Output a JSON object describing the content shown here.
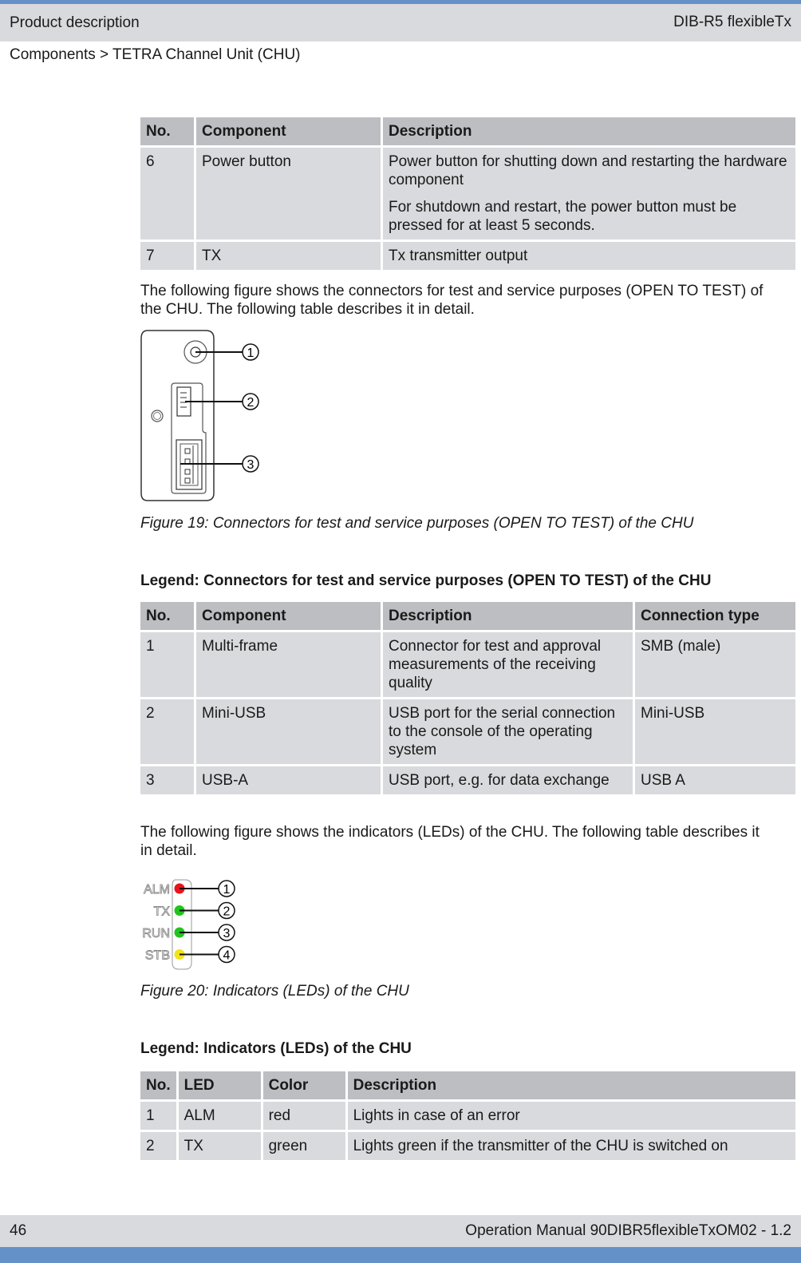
{
  "header": {
    "section": "Product description",
    "product": "DIB-R5 flexibleTx",
    "breadcrumb": "Components > TETRA Channel Unit (CHU)"
  },
  "table1": {
    "headers": [
      "No.",
      "Component",
      "Description"
    ],
    "rows": [
      {
        "no": "6",
        "component": "Power button",
        "description": [
          "Power button for shutting down and restarting the hardware component",
          "For shutdown and restart, the power button must be pressed for at least 5 seconds."
        ]
      },
      {
        "no": "7",
        "component": "TX",
        "description": [
          "Tx transmitter output"
        ]
      }
    ]
  },
  "para1": "The following figure shows the connectors for test and service purposes (OPEN TO TEST) of the CHU. The following table describes it in detail.",
  "figure19": {
    "callouts": [
      "1",
      "2",
      "3"
    ],
    "caption": "Figure 19: Connectors for test and service purposes (OPEN TO TEST) of the CHU"
  },
  "legend1": {
    "title": "Legend: Connectors for test and service purposes (OPEN TO TEST) of the CHU",
    "headers": [
      "No.",
      "Component",
      "Description",
      "Connection type"
    ],
    "rows": [
      {
        "no": "1",
        "component": "Multi-frame",
        "description": "Connector for test and approval measurements of the receiving quality",
        "type": "SMB (male)"
      },
      {
        "no": "2",
        "component": "Mini-USB",
        "description": "USB port for the serial connection to the console of the operating system",
        "type": "Mini-USB"
      },
      {
        "no": "3",
        "component": "USB-A",
        "description": "USB port, e.g. for data exchange",
        "type": "USB A"
      }
    ]
  },
  "para2": "The following figure shows the indicators (LEDs) of the CHU. The following table describes it in detail.",
  "figure20": {
    "leds": [
      {
        "label": "ALM",
        "callout": "1",
        "color": "#e8141a"
      },
      {
        "label": "TX",
        "callout": "2",
        "color": "#22c41e"
      },
      {
        "label": "RUN",
        "callout": "3",
        "color": "#22c41e"
      },
      {
        "label": "STB",
        "callout": "4",
        "color": "#f2e31a"
      }
    ],
    "caption": "Figure 20: Indicators (LEDs) of the CHU"
  },
  "legend2": {
    "title": "Legend: Indicators (LEDs) of the CHU",
    "headers": [
      "No.",
      "LED",
      "Color",
      "Description"
    ],
    "rows": [
      {
        "no": "1",
        "led": "ALM",
        "color": "red",
        "description": "Lights in case of an error"
      },
      {
        "no": "2",
        "led": "TX",
        "color": "green",
        "description": "Lights green if the transmitter of the CHU is switched on"
      }
    ]
  },
  "footer": {
    "page": "46",
    "doc": "Operation Manual 90DIBR5flexibleTxOM02 - 1.2"
  }
}
